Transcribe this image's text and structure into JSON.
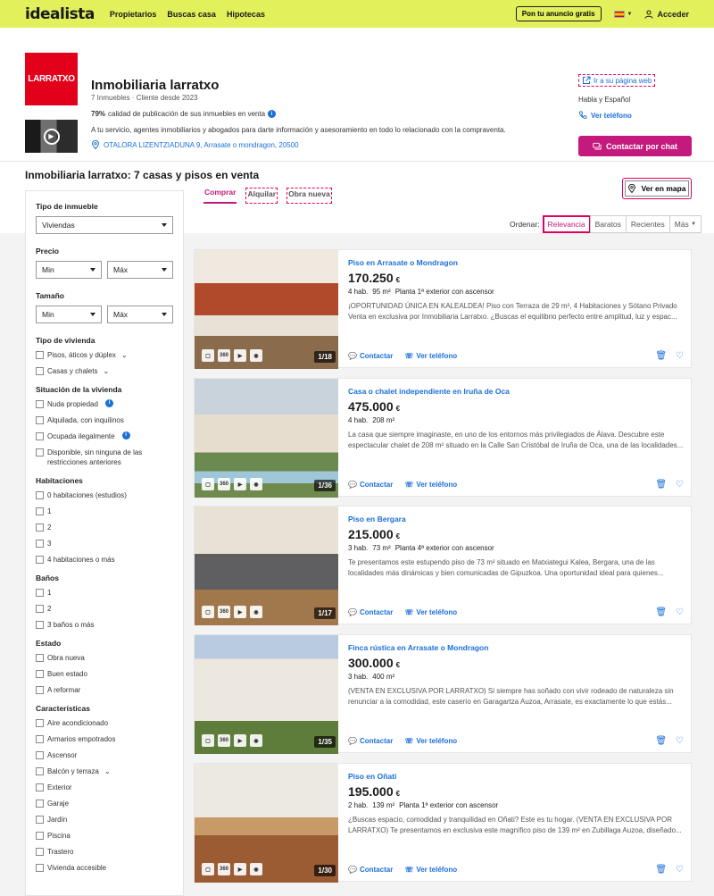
{
  "header": {
    "logo": "idealista",
    "nav": [
      "Propietarios",
      "Buscas casa",
      "Hipotecas"
    ],
    "publish_label": "Pon tu anuncio gratis",
    "login_label": "Acceder"
  },
  "agency": {
    "logo_text": "LARRATXO",
    "name": "Inmobiliaria larratxo",
    "meta": "7 Inmuebles · Cliente desde 2023",
    "quality_pct": "79%",
    "quality_text": "calidad de publicación de sus inmuebles en venta",
    "description": "A tu servicio, agentes inmobiliarios y abogados para darte información y asesoramiento en todo lo relacionado con la compraventa.",
    "address": "OTALORA LIZENTZIADUNA 9, Arrasate o mondragon, 20500",
    "web_link": "Ir a su página web",
    "languages": "Habla y Español",
    "phone_link": "Ver teléfono",
    "chat_button": "Contactar por chat"
  },
  "page": {
    "title": "Inmobiliaria larratxo: 7 casas y pisos en venta",
    "tabs": [
      "Comprar",
      "Alquilar",
      "Obra nueva"
    ],
    "map_button": "Ver en mapa",
    "sort_label": "Ordenar:",
    "sort_options": [
      "Relevancia",
      "Baratos",
      "Recientes",
      "Más"
    ]
  },
  "filters": {
    "tipo_inmueble": {
      "label": "Tipo de inmueble",
      "value": "Viviendas"
    },
    "precio": {
      "label": "Precio",
      "min": "Min",
      "max": "Máx"
    },
    "tamano": {
      "label": "Tamaño",
      "min": "Min",
      "max": "Máx"
    },
    "tipo_vivienda": {
      "label": "Tipo de vivienda",
      "options": [
        "Pisos, áticos y dúplex",
        "Casas y chalets"
      ]
    },
    "situacion": {
      "label": "Situación de la vivienda",
      "options": [
        "Nuda propiedad",
        "Alquilada, con inquilinos",
        "Ocupada ilegalmente",
        "Disponible, sin ninguna de las restricciones anteriores"
      ]
    },
    "habitaciones": {
      "label": "Habitaciones",
      "options": [
        "0 habitaciones (estudios)",
        "1",
        "2",
        "3",
        "4 habitaciones o más"
      ]
    },
    "banos": {
      "label": "Baños",
      "options": [
        "1",
        "2",
        "3 baños o más"
      ]
    },
    "estado": {
      "label": "Estado",
      "options": [
        "Obra nueva",
        "Buen estado",
        "A reformar"
      ]
    },
    "caracteristicas": {
      "label": "Características",
      "options": [
        "Aire acondicionado",
        "Armarios empotrados",
        "Ascensor",
        "Balcón y terraza",
        "Exterior",
        "Garaje",
        "Jardín",
        "Piscina",
        "Trastero",
        "Vivienda accesible"
      ]
    }
  },
  "listing_actions": {
    "contact": "Contactar",
    "phone": "Ver teléfono",
    "icon_360": "360"
  },
  "listings": [
    {
      "title": "Piso en Arrasate o Mondragon",
      "price": "170.250",
      "currency": "€",
      "details": [
        "4 hab.",
        "95 m²",
        "Planta 1ª exterior con ascensor"
      ],
      "description": "¡OPORTUNIDAD ÚNICA EN KALEALDEA! Piso con Terraza de 29 m², 4 Habitaciones y Sótano Privado Venta en exclusiva por Inmobiliaria Larratxo. ¿Buscas el equilibrio perfecto entre amplitud, luz y espac...",
      "photo_counter": "1/18"
    },
    {
      "title": "Casa o chalet independiente en Iruña de Oca",
      "price": "475.000",
      "currency": "€",
      "details": [
        "4 hab.",
        "208 m²"
      ],
      "description": "La casa que siempre imaginaste, en uno de los entornos más privilegiados de Álava. Descubre este espectacular chalet de 208 m² situado en la Calle San Cristóbal de Iruña de Oca, una de las localidades...",
      "photo_counter": "1/36"
    },
    {
      "title": "Piso en Bergara",
      "price": "215.000",
      "currency": "€",
      "details": [
        "3 hab.",
        "73 m²",
        "Planta 4ª exterior con ascensor"
      ],
      "description": "Te presentamos este estupendo piso de 73 m² situado en Matxiategui Kalea, Bergara, una de las localidades más dinámicas y bien comunicadas de Gipuzkoa. Una oportunidad ideal para quienes...",
      "photo_counter": "1/17"
    },
    {
      "title": "Finca rústica en Arrasate o Mondragon",
      "price": "300.000",
      "currency": "€",
      "details": [
        "3 hab.",
        "400 m²"
      ],
      "description": "(VENTA EN EXCLUSIVA POR LARRATXO) Si siempre has soñado con vivir rodeado de naturaleza sin renunciar a la comodidad, este caserío en Garagartza Auzoa, Arrasate, es exactamente lo que estás...",
      "photo_counter": "1/35"
    },
    {
      "title": "Piso en Oñati",
      "price": "195.000",
      "currency": "€",
      "details": [
        "2 hab.",
        "139 m²",
        "Planta 1ª exterior con ascensor"
      ],
      "description": "¿Buscas espacio, comodidad y tranquilidad en Oñati? Este es tu hogar. (VENTA EN EXCLUSIVA POR LARRATXO) Te presentamos en exclusiva este magnífico piso de 139 m² en Zubillaga Auzoa, diseñado...",
      "photo_counter": "1/30"
    }
  ],
  "colors": {
    "brand_bar": "#e1f05b",
    "accent": "#c4197d",
    "link": "#1b6fd9",
    "agency_logo": "#e2001a"
  }
}
